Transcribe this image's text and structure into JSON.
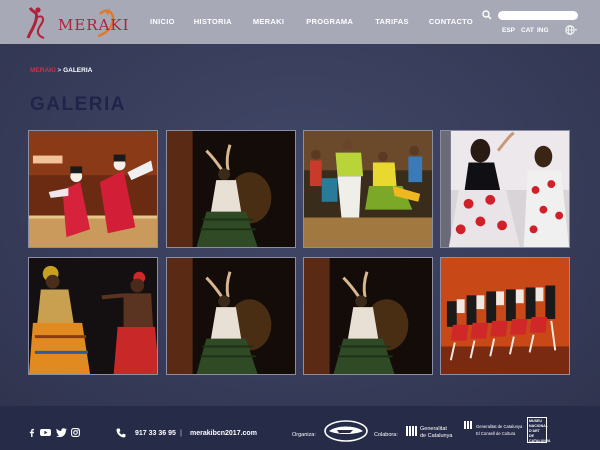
{
  "brand": {
    "name": "MERAKI"
  },
  "nav": {
    "items": [
      "INICIO",
      "HISTORIA",
      "MERAKI",
      "PROGRAMA",
      "TARIFAS",
      "CONTACTO"
    ]
  },
  "search": {
    "placeholder": ""
  },
  "languages": [
    "ESP",
    "CAT",
    "ING"
  ],
  "breadcrumb": {
    "home": "MERAKI",
    "separator": ">",
    "current": "GALERIA"
  },
  "page": {
    "title": "GALERIA"
  },
  "gallery": {
    "photos": [
      {
        "subject": "geisha-dancers"
      },
      {
        "subject": "flamenco-dancer-dark"
      },
      {
        "subject": "street-dance-group"
      },
      {
        "subject": "flamenco-polka-dots"
      },
      {
        "subject": "african-dancers"
      },
      {
        "subject": "flamenco-dancer-dark"
      },
      {
        "subject": "flamenco-dancer-dark"
      },
      {
        "subject": "folk-dance-troupe"
      }
    ]
  },
  "footer": {
    "phone": "917 33 36 95",
    "separator": "|",
    "website": "merakibcn2017.com",
    "organiza_label": "Organiza:",
    "colabora_label": "Colabora:",
    "gencat_line1": "Generalitat",
    "gencat_line2": "de Catalunya",
    "gencat_culture_line1": "Generalitat de Catalunya",
    "gencat_culture_line2": "El Consell de Cultura",
    "museum_line1": "MUSEU",
    "museum_line2": "NACIONAL",
    "museum_line3": "D'ART DE",
    "museum_line4": "CATALUNYA"
  },
  "colors": {
    "header_bg": "#a7a9b7",
    "main_bg": "#3a3f5e",
    "footer_bg": "#262b48",
    "accent_red": "#c8324a",
    "title_navy": "#1f254a"
  },
  "icons": {
    "search": "search-icon",
    "globe": "globe-icon",
    "phone": "phone-icon",
    "social": [
      "facebook-icon",
      "youtube-icon",
      "twitter-icon",
      "instagram-icon"
    ]
  }
}
